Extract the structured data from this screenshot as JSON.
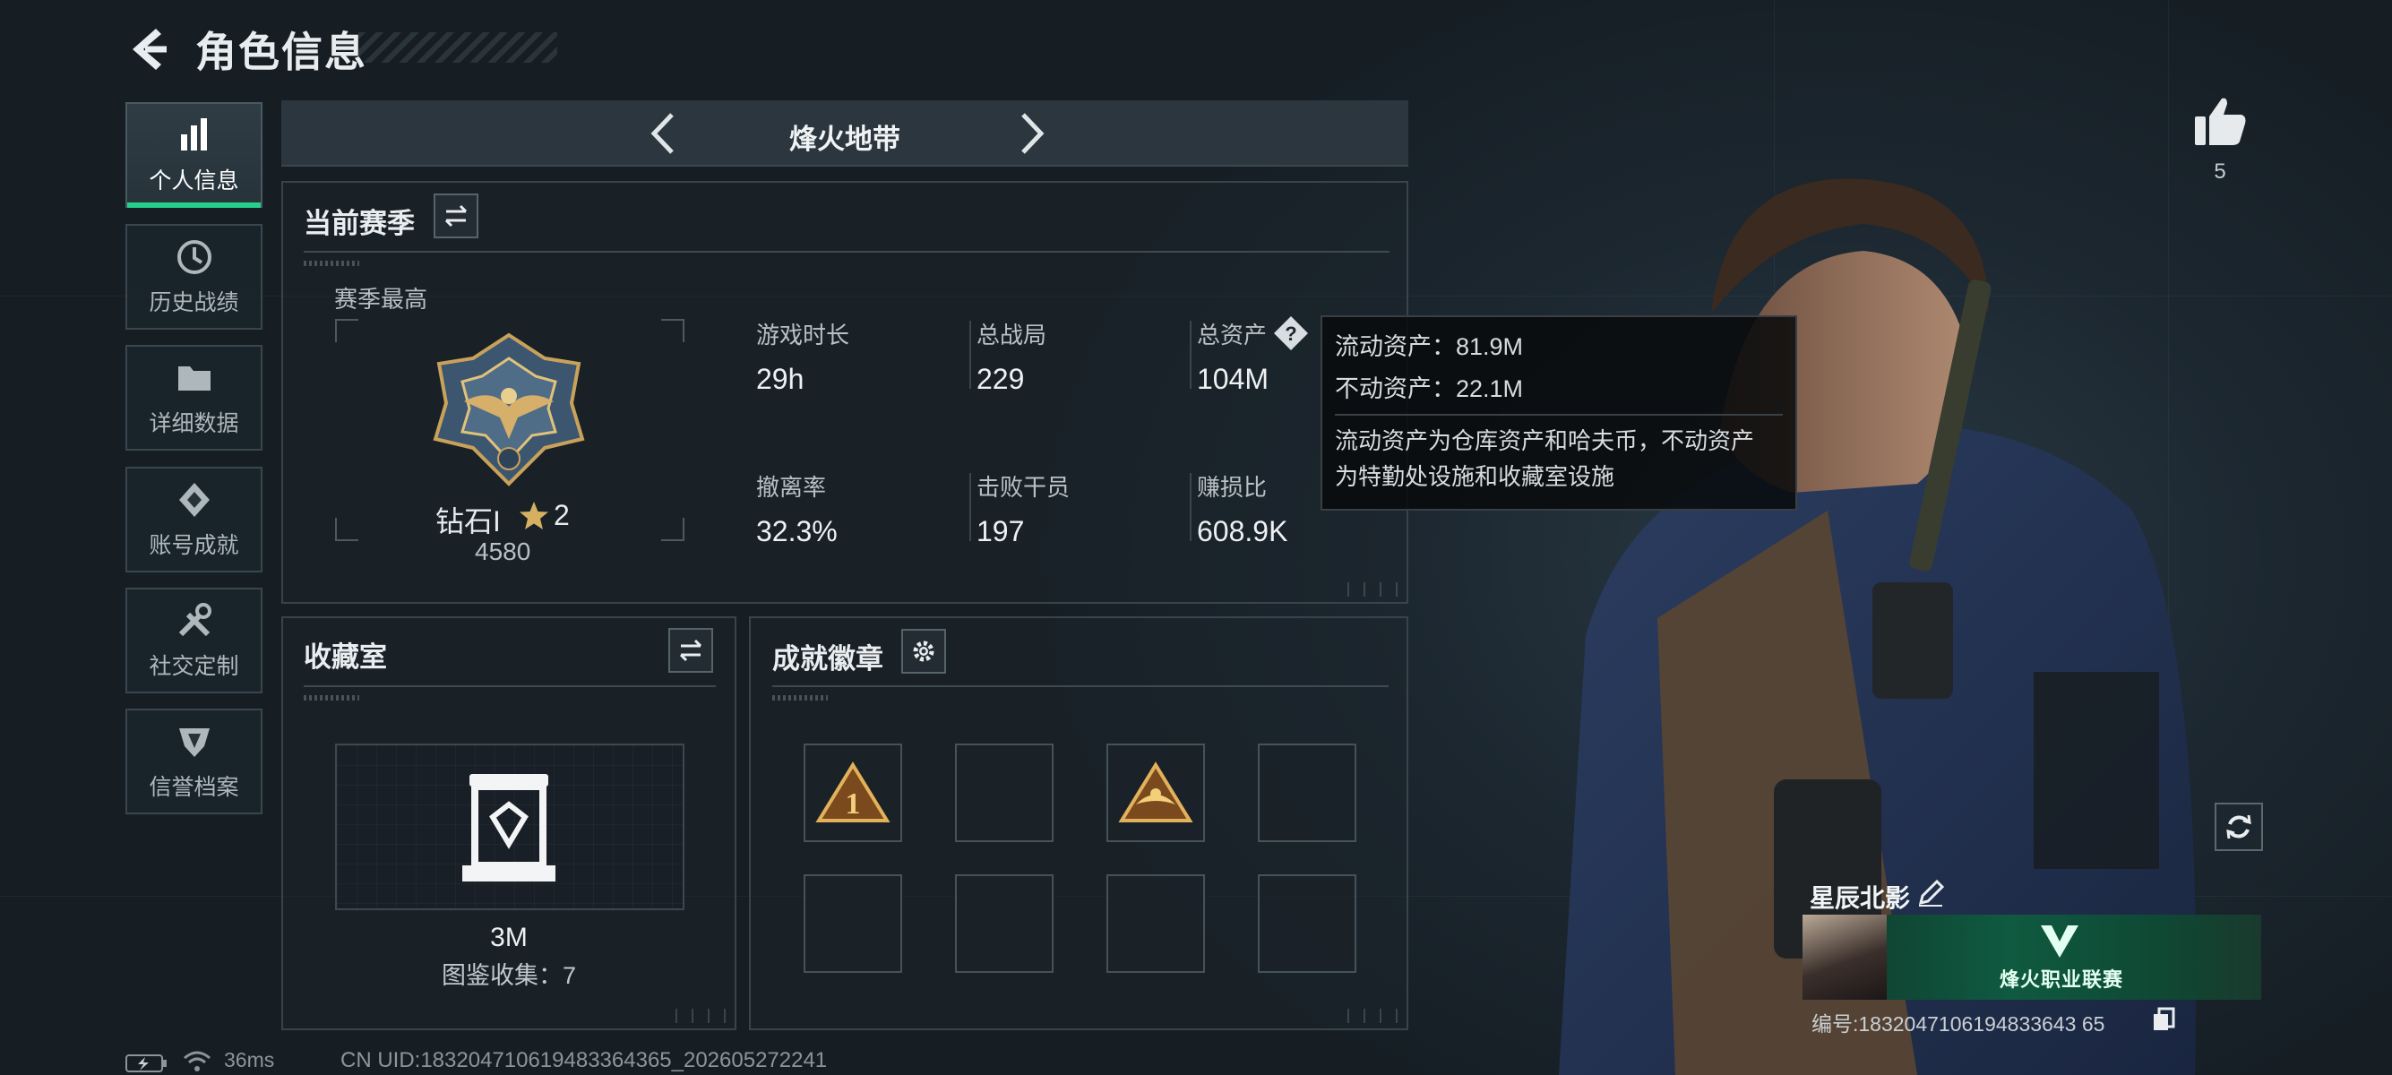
{
  "header": {
    "title": "角色信息",
    "back_icon": "back-arrow-icon"
  },
  "sidebar": {
    "items": [
      {
        "label": "个人信息",
        "icon": "bar-chart-icon",
        "active": true
      },
      {
        "label": "历史战绩",
        "icon": "history-clock-icon",
        "active": false
      },
      {
        "label": "详细数据",
        "icon": "folder-icon",
        "active": false
      },
      {
        "label": "账号成就",
        "icon": "achievement-diamond-icon",
        "active": false
      },
      {
        "label": "社交定制",
        "icon": "tools-icon",
        "active": false
      },
      {
        "label": "信誉档案",
        "icon": "shield-badge-icon",
        "active": false
      }
    ]
  },
  "mode_bar": {
    "title": "烽火地带"
  },
  "season": {
    "title": "当前赛季",
    "best_label": "赛季最高",
    "rank_name": "钻石I",
    "rank_stars": "2",
    "rank_score": "4580",
    "stats": [
      {
        "label": "游戏时长",
        "value": "29h"
      },
      {
        "label": "总战局",
        "value": "229"
      },
      {
        "label": "总资产",
        "value": "104M"
      },
      {
        "label": "撤离率",
        "value": "32.3%"
      },
      {
        "label": "击败干员",
        "value": "197"
      },
      {
        "label": "赚损比",
        "value": "608.9K"
      }
    ]
  },
  "tooltip": {
    "liquid": "流动资产：81.9M",
    "fixed": "不动资产：22.1M",
    "desc_line1": "流动资产为仓库资产和哈夫币，不动资产",
    "desc_line2": "为特勤处设施和收藏室设施"
  },
  "collection": {
    "title": "收藏室",
    "value": "3M",
    "sub": "图鉴收集：7"
  },
  "badges": {
    "title": "成就徽章",
    "slots": [
      {
        "filled": true,
        "icon": "rank-one-badge-icon"
      },
      {
        "filled": false,
        "icon": ""
      },
      {
        "filled": true,
        "icon": "winged-badge-icon"
      },
      {
        "filled": false,
        "icon": ""
      },
      {
        "filled": false,
        "icon": ""
      },
      {
        "filled": false,
        "icon": ""
      },
      {
        "filled": false,
        "icon": ""
      },
      {
        "filled": false,
        "icon": ""
      }
    ]
  },
  "profile": {
    "likes": "5",
    "name": "星辰北影",
    "banner_text": "烽火职业联赛",
    "id_text": "编号:1832047106194833643 65"
  },
  "footer": {
    "ping": "36ms",
    "uid": "CN UID:183204710619483364365_202605272241"
  },
  "colors": {
    "accent_green": "#25d08c",
    "background": "#1b242b",
    "panel_border": "#38444c",
    "rank_gold": "#c9a25a"
  }
}
